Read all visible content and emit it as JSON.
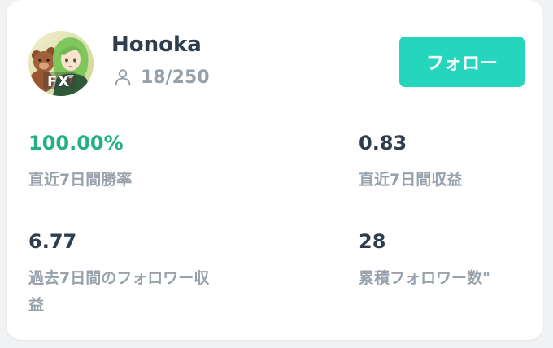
{
  "profile": {
    "name": "Honoka",
    "followers": "18/250",
    "avatar_badge": "FX"
  },
  "actions": {
    "follow_label": "フォロー"
  },
  "stats": [
    {
      "value": "100.00%",
      "label": "直近7日間勝率"
    },
    {
      "value": "0.83",
      "label": "直近7日間収益"
    },
    {
      "value": "6.77",
      "label": "過去7日間のフォロワー収益"
    },
    {
      "value": "28",
      "label": "累積フォロワー数\""
    }
  ],
  "colors": {
    "accent": "#25d6bd",
    "positive": "#23b27f",
    "text_primary": "#2f3d4d",
    "text_secondary": "#98a2ad"
  }
}
